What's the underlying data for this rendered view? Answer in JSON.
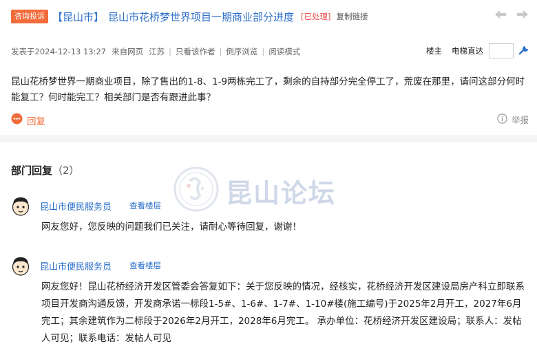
{
  "thread": {
    "tag": "咨询投诉",
    "region": "【昆山市】",
    "title": "昆山市花桥梦世界项目一期商业部分进度",
    "status": "[已处理]",
    "copy_link": "复制链接"
  },
  "meta": {
    "posted_at": "发表于2024-12-13 13:27",
    "source": "来自网页",
    "location": "江苏",
    "author_only": "只看该作者",
    "reverse_order": "倒序浏览",
    "reading_mode": "阅读模式"
  },
  "floor_jump": {
    "floor_label": "楼主",
    "elevator_label": "电梯直达",
    "input_value": ""
  },
  "post": {
    "body": "昆山花桥梦世界一期商业项目，除了售出的1-8、1-9两栋完工了，剩余的自持部分完全停工了，荒废在那里，请问这部分何时能复工？何时能完工？相关部门是否有跟进此事？"
  },
  "actions": {
    "reply": "回复",
    "report": "举报"
  },
  "dept_replies": {
    "title": "部门回复",
    "count": "（2）",
    "items": [
      {
        "name": "昆山市便民服务员",
        "view_floor": "查看楼层",
        "body": "网友您好，您反映的问题我们已关注，请耐心等待回复，谢谢！"
      },
      {
        "name": "昆山市便民服务员",
        "view_floor": "查看楼层",
        "body": "网友您好！昆山花桥经济开发区管委会答复如下：关于您反映的情况，经核实，花桥经济开发区建设局房产科立即联系项目开发商沟通反馈，开发商承诺一标段1-5#、1-6#、1-7#、1-10#楼(施工编号)于2025年2月开工，2027年6月完工；其余建筑作为二标段于2026年2月开工，2028年6月完工。 承办单位：花桥经济开发区建设局；联系人：发帖人可见；联系电话：发帖人可见"
      }
    ]
  },
  "watermark": {
    "text": "昆山论坛"
  },
  "colors": {
    "tag_bg": "#f26b3a",
    "link": "#2b6fc8",
    "status": "#f04848",
    "reply": "#f26b3a"
  }
}
